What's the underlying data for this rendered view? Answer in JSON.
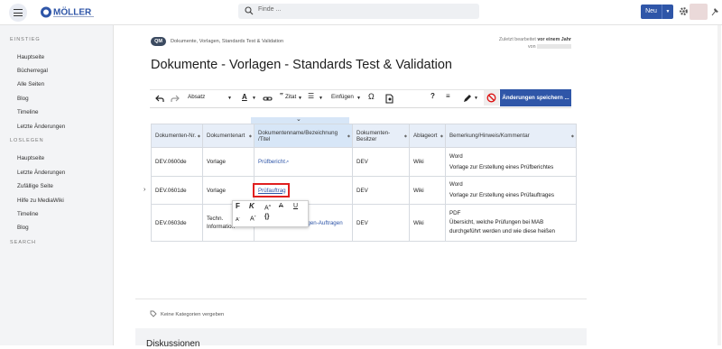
{
  "header": {
    "search_placeholder": "Finde ...",
    "new_button": "Neu",
    "logo_alt": "MÖLLER"
  },
  "sidebar": {
    "section1": "EINSTIEG",
    "items1": [
      "Hauptseite",
      "Bücherregal",
      "Alle Seiten",
      "Blog",
      "Timeline",
      "Letzte Änderungen"
    ],
    "section2": "LOSLEGEN",
    "items2": [
      "Hauptseite",
      "Letzte Änderungen",
      "Zufällige Seite",
      "Hilfe zu MediaWiki",
      "Timeline",
      "Blog"
    ],
    "section3": "SEARCH"
  },
  "page": {
    "badge": "QM",
    "breadcrumb": "Dokumente, Vorlagen, Standards Test & Validation",
    "last_edit_prefix": "Zuletzt bearbeitet",
    "last_edit_time": "vor einem Jahr",
    "last_edit_by": "von",
    "title": "Dokumente - Vorlagen - Standards Test & Validation"
  },
  "toolbar": {
    "paragraph": "Absatz",
    "quote": "Zitat",
    "insert": "Einfügen",
    "help": "?",
    "save": "Änderungen speichern ..."
  },
  "table": {
    "headers": [
      "Dokumenten-Nr.",
      "Dokumentenart",
      "Dokumentenname/Bezeichnung /Titel",
      "Dokumenten-Besitzer",
      "Ablageort",
      "Bemerkung/Hinweis/Kommentar"
    ],
    "rows": [
      {
        "nr": "DEV.0600de",
        "art": "Vorlage",
        "name": "Prüfbericht",
        "owner": "DEV",
        "place": "Wiki",
        "note1": "Word",
        "note2": "Vorlage zur Erstellung eines Prüfberichtes",
        "note3": ""
      },
      {
        "nr": "DEV.0601de",
        "art": "Vorlage",
        "name": "Prüfauftrag",
        "owner": "DEV",
        "place": "Wiki",
        "note1": "Word",
        "note2": "Vorlage zur Erstellung eines Prüfauftrages",
        "note3": ""
      },
      {
        "nr": "DEV.0603de",
        "art": "Techn. Information",
        "name": "…Prüfungen-Auftragen",
        "owner": "DEV",
        "place": "Wiki",
        "note1": "PDF",
        "note2": "Übersicht, welche Prüfungen bei MAB",
        "note3": "durchgeführt werden und wie diese heißen"
      }
    ]
  },
  "popup": {
    "bold": "F",
    "italic": "K",
    "superscript": "A",
    "strike": "A",
    "underline": "U",
    "subscript": "A",
    "big": "A",
    "code": "{}"
  },
  "footer": {
    "categories": "Keine Kategorien vergeben",
    "discussion": "Diskussionen"
  },
  "colors": {
    "primary": "#2f56a8",
    "highlight": "#e02020",
    "table_header": "#e7eef8"
  }
}
